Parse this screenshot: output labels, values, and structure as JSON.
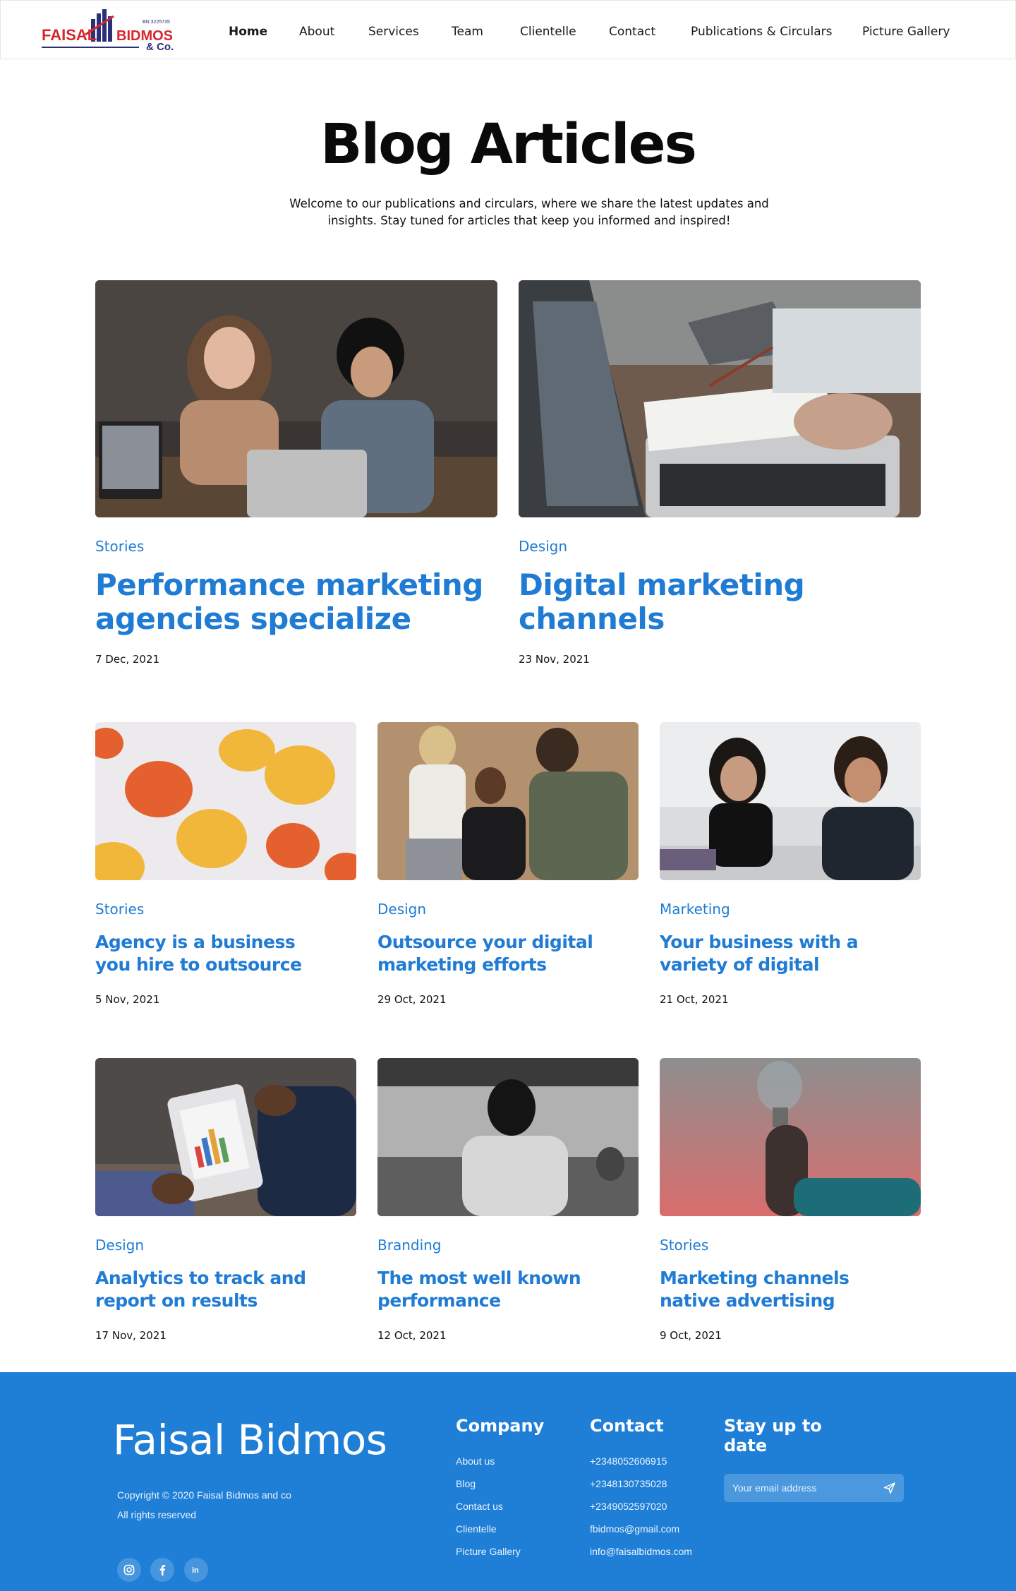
{
  "header": {
    "logo": {
      "text_main": "FAISAL",
      "text_bid": "BIDMOS",
      "text_co": "& Co.",
      "text_reg": "BN:3225735"
    },
    "nav": [
      {
        "label": "Home",
        "active": true
      },
      {
        "label": "About"
      },
      {
        "label": "Services"
      },
      {
        "label": "Team"
      },
      {
        "label": "Clientelle"
      },
      {
        "label": "Contact"
      },
      {
        "label": "Publications & Circulars"
      },
      {
        "label": "Picture Gallery"
      }
    ]
  },
  "hero": {
    "title": "Blog Articles",
    "subtitle": "Welcome to our publications and circulars, where we share the latest updates and insights. Stay tuned for articles that keep you informed and inspired!"
  },
  "articles": [
    {
      "category": "Stories",
      "title": "Performance marketing agencies specialize",
      "date": "7 Dec, 2021",
      "image": "two women laughing at laptops"
    },
    {
      "category": "Design",
      "title": "Digital marketing channels",
      "date": "23 Nov, 2021",
      "image": "hands writing notes beside laptops"
    },
    {
      "category": "Stories",
      "title": "Agency is a business you hire to outsource",
      "date": "5 Nov, 2021",
      "image": "pumpkins on white background"
    },
    {
      "category": "Design",
      "title": "Outsource your digital marketing efforts",
      "date": "29 Oct, 2021",
      "image": "team reviewing a laptop"
    },
    {
      "category": "Marketing",
      "title": "Your business with a variety of digital",
      "date": "21 Oct, 2021",
      "image": "smiling colleagues at a desk"
    },
    {
      "category": "Design",
      "title": "Analytics to track and report on results",
      "date": "17 Nov, 2021",
      "image": "tablet with charts"
    },
    {
      "category": "Branding",
      "title": "The most well known performance",
      "date": "12 Oct, 2021",
      "image": "woman walking past a train"
    },
    {
      "category": "Stories",
      "title": "Marketing channels native advertising",
      "date": "9 Oct, 2021",
      "image": "hand holding a light bulb"
    }
  ],
  "footer": {
    "brand": "Faisal Bidmos",
    "copyright": "Copyright © 2020 Faisal Bidmos and co",
    "rights": "All rights reserved",
    "social": [
      "instagram-icon",
      "facebook-icon",
      "linkedin-icon"
    ],
    "company": {
      "title": "Company",
      "links": [
        "About us",
        "Blog",
        "Contact us",
        "Clientelle",
        "Picture Gallery"
      ]
    },
    "contact": {
      "title": "Contact",
      "items": [
        "+2348052606915",
        "+2348130735028",
        "+2349052597020",
        "fbidmos@gmail.com",
        "info@faisalbidmos.com"
      ]
    },
    "newsletter": {
      "title": "Stay up to date",
      "placeholder": "Your email address"
    }
  },
  "colors": {
    "accent": "#1f7bd3",
    "footer_bg": "#1f7fd6",
    "logo_red": "#d7262e",
    "logo_navy": "#2a2f7a"
  }
}
